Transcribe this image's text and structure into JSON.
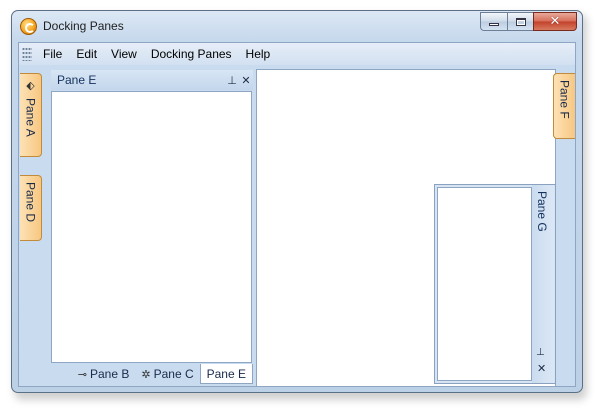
{
  "window": {
    "title": "Docking Panes",
    "close_glyph": "✕"
  },
  "menubar": {
    "items": [
      "File",
      "Edit",
      "View",
      "Docking Panes",
      "Help"
    ]
  },
  "left_auto_hide": {
    "tabs": [
      {
        "label": "Pane A",
        "icon": "pane-a-icon"
      },
      {
        "label": "Pane D"
      }
    ]
  },
  "pane_e": {
    "title": "Pane E",
    "pin_glyph": "⊥",
    "close_glyph": "✕",
    "tabs": [
      {
        "label": "Pane B",
        "icon": "key-icon",
        "glyph": "⊸"
      },
      {
        "label": "Pane C",
        "icon": "gears-icon",
        "glyph": "✲"
      },
      {
        "label": "Pane E",
        "active": true
      }
    ]
  },
  "pane_g": {
    "title": "Pane G",
    "pin_glyph": "⊥",
    "close_glyph": "✕"
  },
  "right_auto_hide": {
    "tabs": [
      {
        "label": "Pane F"
      }
    ]
  }
}
